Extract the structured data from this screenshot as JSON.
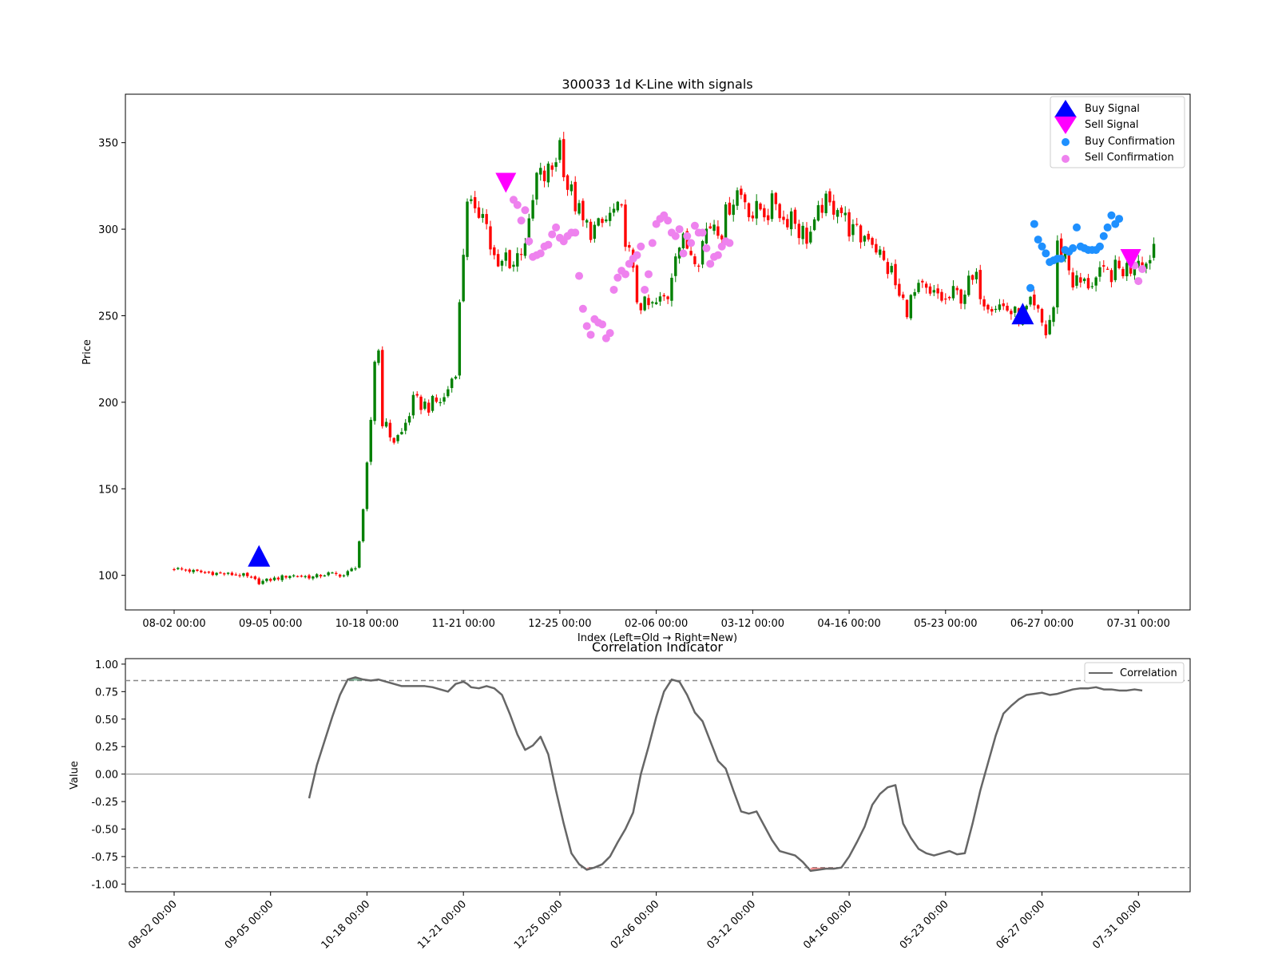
{
  "chart_data": [
    {
      "type": "candlestick",
      "title": "300033 1d K-Line with signals",
      "xlabel": "Index (Left=Old → Right=New)",
      "ylabel": "Price",
      "ylim": [
        80,
        378
      ],
      "yticks": [
        100,
        150,
        200,
        250,
        300,
        350
      ],
      "xticks": [
        "08-02 00:00",
        "09-05 00:00",
        "10-18 00:00",
        "11-21 00:00",
        "12-25 00:00",
        "02-06 00:00",
        "03-12 00:00",
        "04-16 00:00",
        "05-23 00:00",
        "06-27 00:00",
        "07-31 00:00"
      ],
      "xtick_index": [
        0,
        25,
        50,
        75,
        100,
        125,
        150,
        175,
        200,
        225,
        250
      ],
      "legend_position": "top-right",
      "legend": {
        "buy_signal": "Buy Signal",
        "sell_signal": "Sell Signal",
        "buy_confirmation": "Buy Confirmation",
        "sell_confirmation": "Sell Confirmation"
      },
      "colors": {
        "up": "#008000",
        "down": "#ff0000",
        "buy_signal": "#0000ff",
        "sell_signal": "#ff00ff",
        "buy_confirmation": "#1e90ff",
        "sell_confirmation": "#ee82ee"
      },
      "close_path": [
        [
          0,
          104
        ],
        [
          6,
          102
        ],
        [
          12,
          101
        ],
        [
          18,
          100
        ],
        [
          22,
          96
        ],
        [
          26,
          98
        ],
        [
          30,
          100
        ],
        [
          36,
          99
        ],
        [
          40,
          101
        ],
        [
          44,
          100
        ],
        [
          47,
          105
        ],
        [
          48,
          120
        ],
        [
          49,
          135
        ],
        [
          50,
          162
        ],
        [
          51,
          190
        ],
        [
          52,
          225
        ],
        [
          53,
          230
        ],
        [
          54,
          190
        ],
        [
          55,
          185
        ],
        [
          57,
          178
        ],
        [
          59,
          182
        ],
        [
          62,
          200
        ],
        [
          66,
          198
        ],
        [
          70,
          202
        ],
        [
          73,
          220
        ],
        [
          74,
          255
        ],
        [
          76,
          320
        ],
        [
          78,
          305
        ],
        [
          80,
          315
        ],
        [
          82,
          290
        ],
        [
          84,
          275
        ],
        [
          86,
          285
        ],
        [
          88,
          280
        ],
        [
          90,
          290
        ],
        [
          92,
          300
        ],
        [
          94,
          330
        ],
        [
          96,
          330
        ],
        [
          98,
          335
        ],
        [
          100,
          350
        ],
        [
          102,
          325
        ],
        [
          104,
          315
        ],
        [
          106,
          303
        ],
        [
          108,
          300
        ],
        [
          110,
          300
        ],
        [
          112,
          305
        ],
        [
          114,
          310
        ],
        [
          116,
          308
        ],
        [
          118,
          285
        ],
        [
          120,
          260
        ],
        [
          122,
          255
        ],
        [
          124,
          255
        ],
        [
          126,
          258
        ],
        [
          128,
          262
        ],
        [
          130,
          290
        ],
        [
          132,
          292
        ],
        [
          134,
          288
        ],
        [
          136,
          285
        ],
        [
          138,
          300
        ],
        [
          140,
          305
        ],
        [
          142,
          300
        ],
        [
          144,
          315
        ],
        [
          146,
          322
        ],
        [
          148,
          318
        ],
        [
          150,
          308
        ],
        [
          152,
          312
        ],
        [
          154,
          310
        ],
        [
          156,
          317
        ],
        [
          158,
          305
        ],
        [
          160,
          310
        ],
        [
          162,
          300
        ],
        [
          164,
          296
        ],
        [
          166,
          300
        ],
        [
          168,
          315
        ],
        [
          170,
          312
        ],
        [
          172,
          316
        ],
        [
          174,
          305
        ],
        [
          176,
          298
        ],
        [
          178,
          295
        ],
        [
          180,
          298
        ],
        [
          182,
          290
        ],
        [
          184,
          280
        ],
        [
          186,
          275
        ],
        [
          188,
          260
        ],
        [
          190,
          255
        ],
        [
          192,
          262
        ],
        [
          194,
          265
        ],
        [
          196,
          260
        ],
        [
          198,
          262
        ],
        [
          200,
          258
        ],
        [
          202,
          262
        ],
        [
          204,
          262
        ],
        [
          206,
          268
        ],
        [
          208,
          270
        ],
        [
          210,
          260
        ],
        [
          212,
          258
        ],
        [
          214,
          256
        ],
        [
          216,
          254
        ],
        [
          218,
          250
        ],
        [
          220,
          250
        ],
        [
          222,
          255
        ],
        [
          224,
          250
        ],
        [
          226,
          240
        ],
        [
          228,
          255
        ],
        [
          229,
          290
        ],
        [
          231,
          285
        ],
        [
          233,
          270
        ],
        [
          236,
          268
        ],
        [
          240,
          272
        ],
        [
          244,
          276
        ],
        [
          248,
          278
        ],
        [
          250,
          285
        ],
        [
          252,
          280
        ],
        [
          254,
          292
        ]
      ],
      "buy_signals": [
        [
          22,
          111
        ],
        [
          220,
          251
        ]
      ],
      "sell_signals": [
        [
          86,
          327
        ],
        [
          248,
          283
        ]
      ],
      "buy_confirmations": [
        [
          222,
          266
        ],
        [
          223,
          303
        ],
        [
          224,
          294
        ],
        [
          225,
          290
        ],
        [
          226,
          286
        ],
        [
          227,
          281
        ],
        [
          228,
          282
        ],
        [
          229,
          283
        ],
        [
          230,
          283
        ],
        [
          231,
          288
        ],
        [
          232,
          287
        ],
        [
          233,
          289
        ],
        [
          234,
          301
        ],
        [
          235,
          290
        ],
        [
          236,
          289
        ],
        [
          237,
          288
        ],
        [
          238,
          288
        ],
        [
          239,
          288
        ],
        [
          240,
          290
        ],
        [
          241,
          296
        ],
        [
          242,
          301
        ],
        [
          243,
          308
        ],
        [
          244,
          303
        ],
        [
          245,
          306
        ]
      ],
      "sell_confirmations": [
        [
          88,
          317
        ],
        [
          89,
          314
        ],
        [
          90,
          305
        ],
        [
          91,
          311
        ],
        [
          92,
          293
        ],
        [
          93,
          284
        ],
        [
          94,
          285
        ],
        [
          95,
          286
        ],
        [
          96,
          290
        ],
        [
          97,
          291
        ],
        [
          98,
          297
        ],
        [
          99,
          301
        ],
        [
          100,
          295
        ],
        [
          101,
          293
        ],
        [
          102,
          296
        ],
        [
          103,
          298
        ],
        [
          104,
          298
        ],
        [
          105,
          273
        ],
        [
          106,
          254
        ],
        [
          107,
          244
        ],
        [
          108,
          239
        ],
        [
          109,
          248
        ],
        [
          110,
          246
        ],
        [
          111,
          245
        ],
        [
          112,
          237
        ],
        [
          113,
          240
        ],
        [
          114,
          265
        ],
        [
          115,
          272
        ],
        [
          116,
          276
        ],
        [
          117,
          274
        ],
        [
          118,
          280
        ],
        [
          119,
          283
        ],
        [
          120,
          285
        ],
        [
          121,
          290
        ],
        [
          122,
          265
        ],
        [
          123,
          274
        ],
        [
          124,
          292
        ],
        [
          125,
          303
        ],
        [
          126,
          306
        ],
        [
          127,
          308
        ],
        [
          128,
          305
        ],
        [
          129,
          298
        ],
        [
          130,
          296
        ],
        [
          131,
          300
        ],
        [
          132,
          286
        ],
        [
          133,
          296
        ],
        [
          134,
          292
        ],
        [
          135,
          302
        ],
        [
          136,
          298
        ],
        [
          137,
          298
        ],
        [
          138,
          289
        ],
        [
          139,
          280
        ],
        [
          140,
          284
        ],
        [
          141,
          285
        ],
        [
          142,
          290
        ],
        [
          143,
          293
        ],
        [
          144,
          292
        ],
        [
          249,
          279
        ],
        [
          250,
          270
        ],
        [
          251,
          277
        ]
      ]
    },
    {
      "type": "line",
      "title": "Correlation Indicator",
      "ylabel": "Value",
      "ylim": [
        -1.07,
        1.05
      ],
      "yticks": [
        "-1.00",
        "-0.75",
        "-0.50",
        "-0.25",
        "0.00",
        "0.25",
        "0.50",
        "0.75",
        "1.00"
      ],
      "ytick_values": [
        -1.0,
        -0.75,
        -0.5,
        -0.25,
        0.0,
        0.25,
        0.5,
        0.75,
        1.0
      ],
      "xticks": [
        "08-02 00:00",
        "09-05 00:00",
        "10-18 00:00",
        "11-21 00:00",
        "12-25 00:00",
        "02-06 00:00",
        "03-12 00:00",
        "04-16 00:00",
        "05-23 00:00",
        "06-27 00:00",
        "07-31 00:00"
      ],
      "xtick_index": [
        0,
        25,
        50,
        75,
        100,
        125,
        150,
        175,
        200,
        225,
        250
      ],
      "thresholds": [
        0.85,
        -0.85
      ],
      "legend_position": "top-right",
      "series": [
        {
          "name": "Correlation",
          "color": "#666666",
          "x": [
            35,
            37,
            39,
            41,
            43,
            45,
            47,
            49,
            51,
            53,
            55,
            57,
            59,
            61,
            63,
            65,
            67,
            69,
            71,
            73,
            75,
            76,
            77,
            79,
            81,
            83,
            85,
            87,
            89,
            91,
            93,
            95,
            97,
            99,
            101,
            103,
            105,
            107,
            109,
            111,
            113,
            115,
            117,
            119,
            121,
            123,
            125,
            127,
            129,
            131,
            133,
            135,
            137,
            139,
            141,
            143,
            145,
            147,
            149,
            151,
            153,
            155,
            157,
            159,
            161,
            163,
            165,
            167,
            169,
            171,
            173,
            175,
            177,
            179,
            181,
            183,
            185,
            187,
            189,
            191,
            193,
            195,
            197,
            199,
            201,
            203,
            205,
            207,
            209,
            211,
            213,
            215,
            217,
            219,
            221,
            223,
            225,
            227,
            229,
            231,
            233,
            235,
            237,
            239,
            241,
            243,
            245,
            247,
            249,
            251
          ],
          "values": [
            -0.22,
            0.08,
            0.3,
            0.52,
            0.72,
            0.86,
            0.88,
            0.86,
            0.85,
            0.86,
            0.84,
            0.82,
            0.8,
            0.8,
            0.8,
            0.8,
            0.79,
            0.77,
            0.75,
            0.82,
            0.84,
            0.82,
            0.79,
            0.78,
            0.8,
            0.78,
            0.72,
            0.55,
            0.36,
            0.22,
            0.26,
            0.34,
            0.18,
            -0.15,
            -0.45,
            -0.72,
            -0.82,
            -0.87,
            -0.85,
            -0.82,
            -0.75,
            -0.62,
            -0.5,
            -0.35,
            0.0,
            0.25,
            0.52,
            0.75,
            0.86,
            0.84,
            0.72,
            0.56,
            0.48,
            0.3,
            0.12,
            0.05,
            -0.15,
            -0.34,
            -0.36,
            -0.34,
            -0.47,
            -0.6,
            -0.7,
            -0.72,
            -0.74,
            -0.8,
            -0.88,
            -0.87,
            -0.86,
            -0.86,
            -0.85,
            -0.75,
            -0.62,
            -0.48,
            -0.28,
            -0.18,
            -0.12,
            -0.1,
            -0.45,
            -0.58,
            -0.68,
            -0.72,
            -0.74,
            -0.72,
            -0.7,
            -0.73,
            -0.72,
            -0.45,
            -0.15,
            0.1,
            0.35,
            0.55,
            0.62,
            0.68,
            0.72,
            0.73,
            0.74,
            0.72,
            0.73,
            0.75,
            0.77,
            0.78,
            0.78,
            0.79,
            0.77,
            0.77,
            0.76,
            0.76,
            0.77,
            0.76
          ]
        }
      ]
    }
  ]
}
